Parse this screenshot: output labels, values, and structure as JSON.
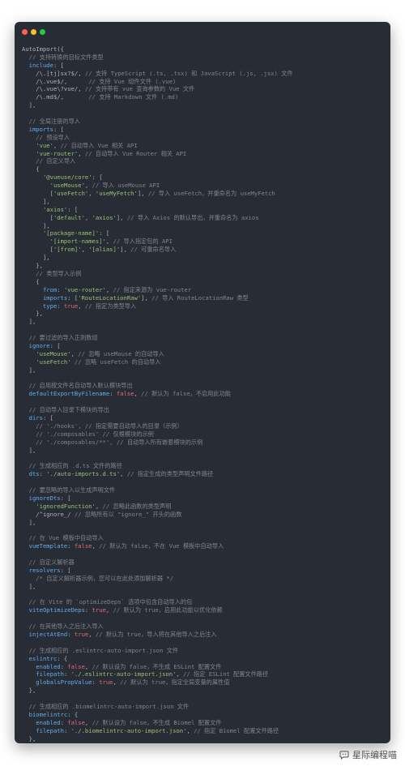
{
  "window": {
    "title": ""
  },
  "colors": {
    "background": "#282c34",
    "text": "#abb2bf",
    "key": "#61afef",
    "string": "#98c379",
    "comment": "#7f848e",
    "boolean": "#e06c75",
    "number": "#d19a66",
    "dot_red": "#ff5f56",
    "dot_yellow": "#ffbd2e",
    "dot_green": "#27c93f"
  },
  "code_lines": [
    [
      [
        "text",
        "AutoImport({"
      ]
    ],
    [
      [
        "com",
        "  // 支持转换的目标文件类型"
      ]
    ],
    [
      [
        "key",
        "  include"
      ],
      [
        "text",
        ": ["
      ]
    ],
    [
      [
        "text",
        "    /\\.[tj]sx?$/, "
      ],
      [
        "com",
        "// 支持 TypeScript (.ts, .tsx) 和 JavaScript (.js, .jsx) 文件"
      ]
    ],
    [
      [
        "text",
        "    /\\.vue$/,      "
      ],
      [
        "com",
        "// 支持 Vue 组件文件 (.vue)"
      ]
    ],
    [
      [
        "text",
        "    /\\.vue\\?vue/, "
      ],
      [
        "com",
        "// 支持带有 vue 查询参数的 Vue 文件"
      ]
    ],
    [
      [
        "text",
        "    /\\.md$/,       "
      ],
      [
        "com",
        "// 支持 Markdown 文件 (.md)"
      ]
    ],
    [
      [
        "text",
        "  ],"
      ]
    ],
    [
      [
        "text",
        ""
      ]
    ],
    [
      [
        "com",
        "  // 全局注册的导入"
      ]
    ],
    [
      [
        "key",
        "  imports"
      ],
      [
        "text",
        ": ["
      ]
    ],
    [
      [
        "com",
        "    // 预设导入"
      ]
    ],
    [
      [
        "str",
        "    'vue'"
      ],
      [
        "text",
        ", "
      ],
      [
        "com",
        "// 自动导入 Vue 相关 API"
      ]
    ],
    [
      [
        "str",
        "    'vue-router'"
      ],
      [
        "text",
        ", "
      ],
      [
        "com",
        "// 自动导入 Vue Router 相关 API"
      ]
    ],
    [
      [
        "com",
        "    // 自定义导入"
      ]
    ],
    [
      [
        "text",
        "    {"
      ]
    ],
    [
      [
        "str",
        "      '@vueuse/core'"
      ],
      [
        "text",
        ": ["
      ]
    ],
    [
      [
        "str",
        "        'useMouse'"
      ],
      [
        "text",
        ", "
      ],
      [
        "com",
        "// 导入 useMouse API"
      ]
    ],
    [
      [
        "text",
        "        ["
      ],
      [
        "str",
        "'useFetch'"
      ],
      [
        "text",
        ", "
      ],
      [
        "str",
        "'useMyFetch'"
      ],
      [
        "text",
        "], "
      ],
      [
        "com",
        "// 导入 useFetch，并重命名为 useMyFetch"
      ]
    ],
    [
      [
        "text",
        "      ],"
      ]
    ],
    [
      [
        "str",
        "      'axios'"
      ],
      [
        "text",
        ": ["
      ]
    ],
    [
      [
        "text",
        "        ["
      ],
      [
        "str",
        "'default'"
      ],
      [
        "text",
        ", "
      ],
      [
        "str",
        "'axios'"
      ],
      [
        "text",
        "], "
      ],
      [
        "com",
        "// 导入 Axios 的默认导出，并重命名为 axios"
      ]
    ],
    [
      [
        "text",
        "      ],"
      ]
    ],
    [
      [
        "text",
        "      "
      ],
      [
        "str",
        "'[package-name]'"
      ],
      [
        "text",
        ": ["
      ]
    ],
    [
      [
        "str",
        "        '[import-names]'"
      ],
      [
        "text",
        ", "
      ],
      [
        "com",
        "// 导入指定包的 API"
      ]
    ],
    [
      [
        "text",
        "        ["
      ],
      [
        "str",
        "'[from]'"
      ],
      [
        "text",
        ", "
      ],
      [
        "str",
        "'[alias]'"
      ],
      [
        "text",
        "], "
      ],
      [
        "com",
        "// 可重命名导入"
      ]
    ],
    [
      [
        "text",
        "      ],"
      ]
    ],
    [
      [
        "text",
        "    },"
      ]
    ],
    [
      [
        "com",
        "    // 类型导入示例"
      ]
    ],
    [
      [
        "text",
        "    {"
      ]
    ],
    [
      [
        "key",
        "      from"
      ],
      [
        "text",
        ": "
      ],
      [
        "str",
        "'vue-router'"
      ],
      [
        "text",
        ", "
      ],
      [
        "com",
        "// 指定来源为 vue-router"
      ]
    ],
    [
      [
        "key",
        "      imports"
      ],
      [
        "text",
        ": ["
      ],
      [
        "str",
        "'RouteLocationRaw'"
      ],
      [
        "text",
        "], "
      ],
      [
        "com",
        "// 导入 RouteLocationRaw 类型"
      ]
    ],
    [
      [
        "key",
        "      type"
      ],
      [
        "text",
        ": "
      ],
      [
        "bool",
        "true"
      ],
      [
        "text",
        ", "
      ],
      [
        "com",
        "// 指定为类型导入"
      ]
    ],
    [
      [
        "text",
        "    },"
      ]
    ],
    [
      [
        "text",
        "  ],"
      ]
    ],
    [
      [
        "text",
        ""
      ]
    ],
    [
      [
        "com",
        "  // 要过滤的导入正则数组"
      ]
    ],
    [
      [
        "key",
        "  ignore"
      ],
      [
        "text",
        ": ["
      ]
    ],
    [
      [
        "str",
        "    'useMouse'"
      ],
      [
        "text",
        ", "
      ],
      [
        "com",
        "// 忽略 useMouse 的自动导入"
      ]
    ],
    [
      [
        "str",
        "    'useFetch'"
      ],
      [
        "text",
        " "
      ],
      [
        "com",
        "// 忽略 useFetch 的自动导入"
      ]
    ],
    [
      [
        "text",
        "  ],"
      ]
    ],
    [
      [
        "text",
        ""
      ]
    ],
    [
      [
        "com",
        "  // 启用按文件名自动导入默认模块导出"
      ]
    ],
    [
      [
        "key",
        "  defaultExportByFilename"
      ],
      [
        "text",
        ": "
      ],
      [
        "bool",
        "false"
      ],
      [
        "text",
        ", "
      ],
      [
        "com",
        "// 默认为 false，不启用此功能"
      ]
    ],
    [
      [
        "text",
        ""
      ]
    ],
    [
      [
        "com",
        "  // 自动导入目录下模块的导出"
      ]
    ],
    [
      [
        "key",
        "  dirs"
      ],
      [
        "text",
        ": ["
      ]
    ],
    [
      [
        "com",
        "    // './hooks', // 指定需要自动导入的目录（示例）"
      ]
    ],
    [
      [
        "com",
        "    // './composables' // 仅根模块的示例"
      ]
    ],
    [
      [
        "com",
        "    // './composables/**', // 自动导入所有嵌套模块的示例"
      ]
    ],
    [
      [
        "text",
        "  ],"
      ]
    ],
    [
      [
        "text",
        ""
      ]
    ],
    [
      [
        "com",
        "  // 生成相应的 .d.ts 文件的路径"
      ]
    ],
    [
      [
        "key",
        "  dts"
      ],
      [
        "text",
        ": "
      ],
      [
        "str",
        "'./auto-imports.d.ts'"
      ],
      [
        "text",
        ", "
      ],
      [
        "com",
        "// 指定生成的类型声明文件路径"
      ]
    ],
    [
      [
        "text",
        ""
      ]
    ],
    [
      [
        "com",
        "  // 要忽略的导入以生成声明文件"
      ]
    ],
    [
      [
        "key",
        "  ignoreDts"
      ],
      [
        "text",
        ": ["
      ]
    ],
    [
      [
        "str",
        "    'ignoredFunction'"
      ],
      [
        "text",
        ", "
      ],
      [
        "com",
        "// 忽略此函数的类型声明"
      ]
    ],
    [
      [
        "text",
        "    /^ignore_/ "
      ],
      [
        "com",
        "// 忽略所有以 \"ignore_\" 开头的函数"
      ]
    ],
    [
      [
        "text",
        "  ],"
      ]
    ],
    [
      [
        "text",
        ""
      ]
    ],
    [
      [
        "com",
        "  // 在 Vue 模板中自动导入"
      ]
    ],
    [
      [
        "key",
        "  vueTemplate"
      ],
      [
        "text",
        ": "
      ],
      [
        "bool",
        "false"
      ],
      [
        "text",
        ", "
      ],
      [
        "com",
        "// 默认为 false，不在 Vue 模板中自动导入"
      ]
    ],
    [
      [
        "text",
        ""
      ]
    ],
    [
      [
        "com",
        "  // 自定义解析器"
      ]
    ],
    [
      [
        "key",
        "  resolvers"
      ],
      [
        "text",
        ": ["
      ]
    ],
    [
      [
        "com",
        "    /* 自定义解析器示例，您可以在此处添加解析器 */"
      ]
    ],
    [
      [
        "text",
        "  ],"
      ]
    ],
    [
      [
        "text",
        ""
      ]
    ],
    [
      [
        "com",
        "  // 在 Vite 的 `optimizeDeps` 选项中包含自动导入的包"
      ]
    ],
    [
      [
        "key",
        "  viteOptimizeDeps"
      ],
      [
        "text",
        ": "
      ],
      [
        "bool",
        "true"
      ],
      [
        "text",
        ", "
      ],
      [
        "com",
        "// 默认为 true，启用此功能以优化依赖"
      ]
    ],
    [
      [
        "text",
        ""
      ]
    ],
    [
      [
        "com",
        "  // 在其他导入之后注入导入"
      ]
    ],
    [
      [
        "key",
        "  injectAtEnd"
      ],
      [
        "text",
        ": "
      ],
      [
        "bool",
        "true"
      ],
      [
        "text",
        ", "
      ],
      [
        "com",
        "// 默认为 true，导入将在其他导入之后注入"
      ]
    ],
    [
      [
        "text",
        ""
      ]
    ],
    [
      [
        "com",
        "  // 生成相应的 .eslintrc-auto-import.json 文件"
      ]
    ],
    [
      [
        "key",
        "  eslintrc"
      ],
      [
        "text",
        ": {"
      ]
    ],
    [
      [
        "key",
        "    enabled"
      ],
      [
        "text",
        ": "
      ],
      [
        "bool",
        "false"
      ],
      [
        "text",
        ", "
      ],
      [
        "com",
        "// 默认设为 false，不生成 ESLint 配置文件"
      ]
    ],
    [
      [
        "key",
        "    filepath"
      ],
      [
        "text",
        ": "
      ],
      [
        "str",
        "'./.eslintrc-auto-import.json'"
      ],
      [
        "text",
        ", "
      ],
      [
        "com",
        "// 指定 ESLint 配置文件路径"
      ]
    ],
    [
      [
        "key",
        "    globalsPropValue"
      ],
      [
        "text",
        ": "
      ],
      [
        "bool",
        "true"
      ],
      [
        "text",
        ", "
      ],
      [
        "com",
        "// 默认为 true，指定全局变量的属性值"
      ]
    ],
    [
      [
        "text",
        "  },"
      ]
    ],
    [
      [
        "text",
        ""
      ]
    ],
    [
      [
        "com",
        "  // 生成相应的 .biomelintrc-auto-import.json 文件"
      ]
    ],
    [
      [
        "key",
        "  biomelintrc"
      ],
      [
        "text",
        ": {"
      ]
    ],
    [
      [
        "key",
        "    enabled"
      ],
      [
        "text",
        ": "
      ],
      [
        "bool",
        "false"
      ],
      [
        "text",
        ", "
      ],
      [
        "com",
        "// 默认设为 false，不生成 Biomel 配置文件"
      ]
    ],
    [
      [
        "key",
        "    filepath"
      ],
      [
        "text",
        ": "
      ],
      [
        "str",
        "'./.biomelintrc-auto-import.json'"
      ],
      [
        "text",
        ", "
      ],
      [
        "com",
        "// 指定 Biomel 配置文件路径"
      ]
    ],
    [
      [
        "text",
        "  },"
      ]
    ],
    [
      [
        "text",
        "});"
      ]
    ]
  ],
  "watermark": {
    "icon": "chat-bubble-icon",
    "text": "星际编程喵"
  }
}
